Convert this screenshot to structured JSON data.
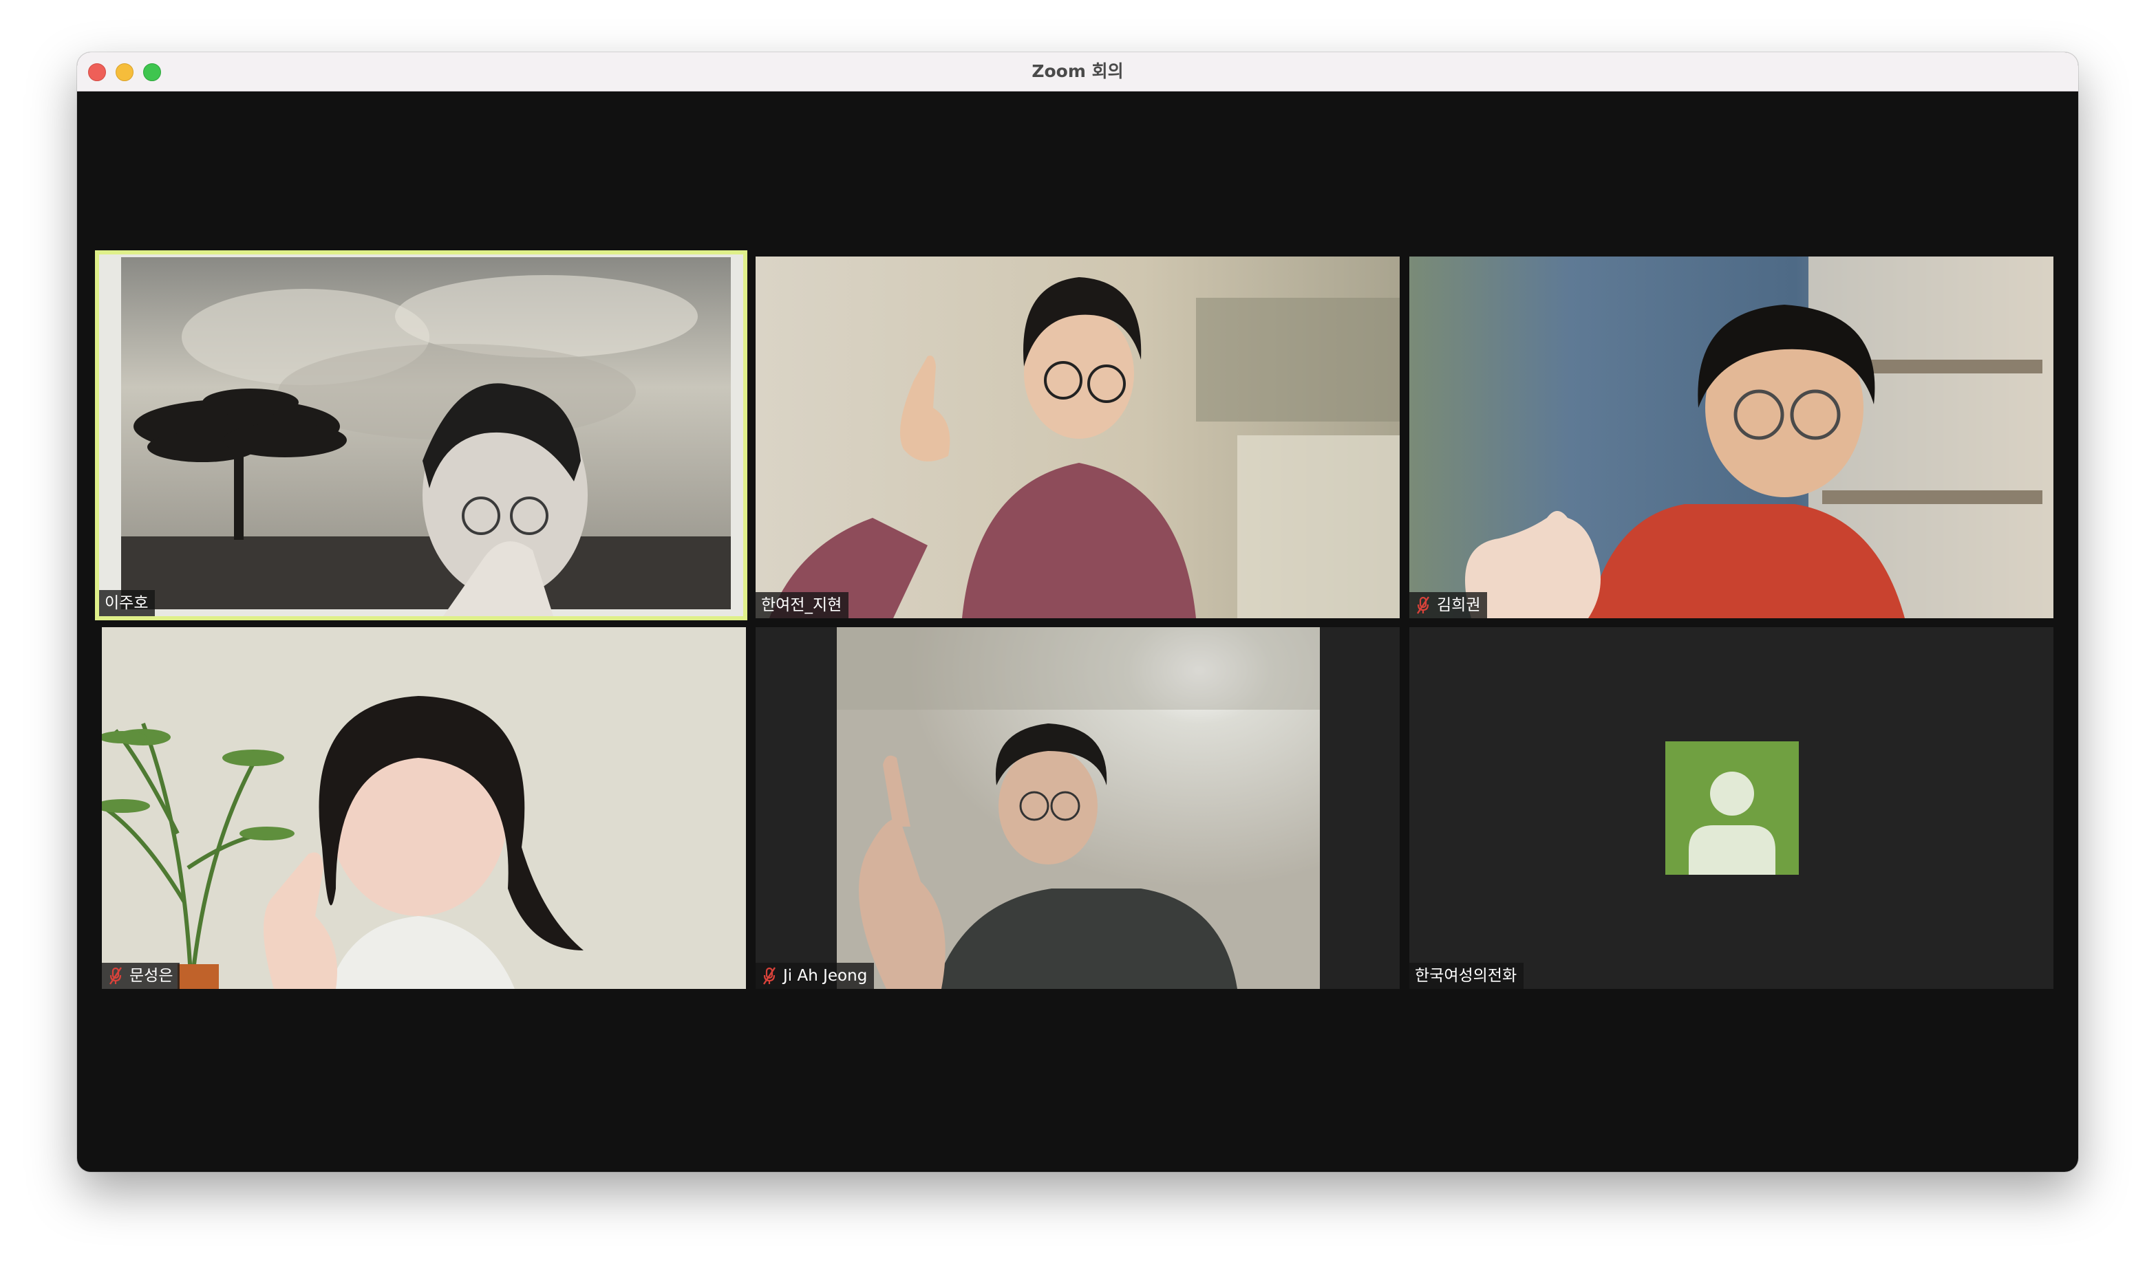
{
  "window": {
    "title": "Zoom 회의"
  },
  "colors": {
    "active_speaker_border": "#dff08a",
    "tile_bg": "#232323",
    "window_bg": "#111111",
    "avatar_bg": "#70a041",
    "muted_mic": "#d9423a"
  },
  "participants": [
    {
      "name": "이주호",
      "muted": false,
      "video": true,
      "active_speaker": true
    },
    {
      "name": "한여전_지현",
      "muted": false,
      "video": true,
      "active_speaker": false
    },
    {
      "name": "김희권",
      "muted": true,
      "video": true,
      "active_speaker": false
    },
    {
      "name": "문성은",
      "muted": true,
      "video": true,
      "active_speaker": false
    },
    {
      "name": "Ji Ah Jeong",
      "muted": true,
      "video": true,
      "active_speaker": false
    },
    {
      "name": "한국여성의전화",
      "muted": false,
      "video": false,
      "active_speaker": false
    }
  ]
}
